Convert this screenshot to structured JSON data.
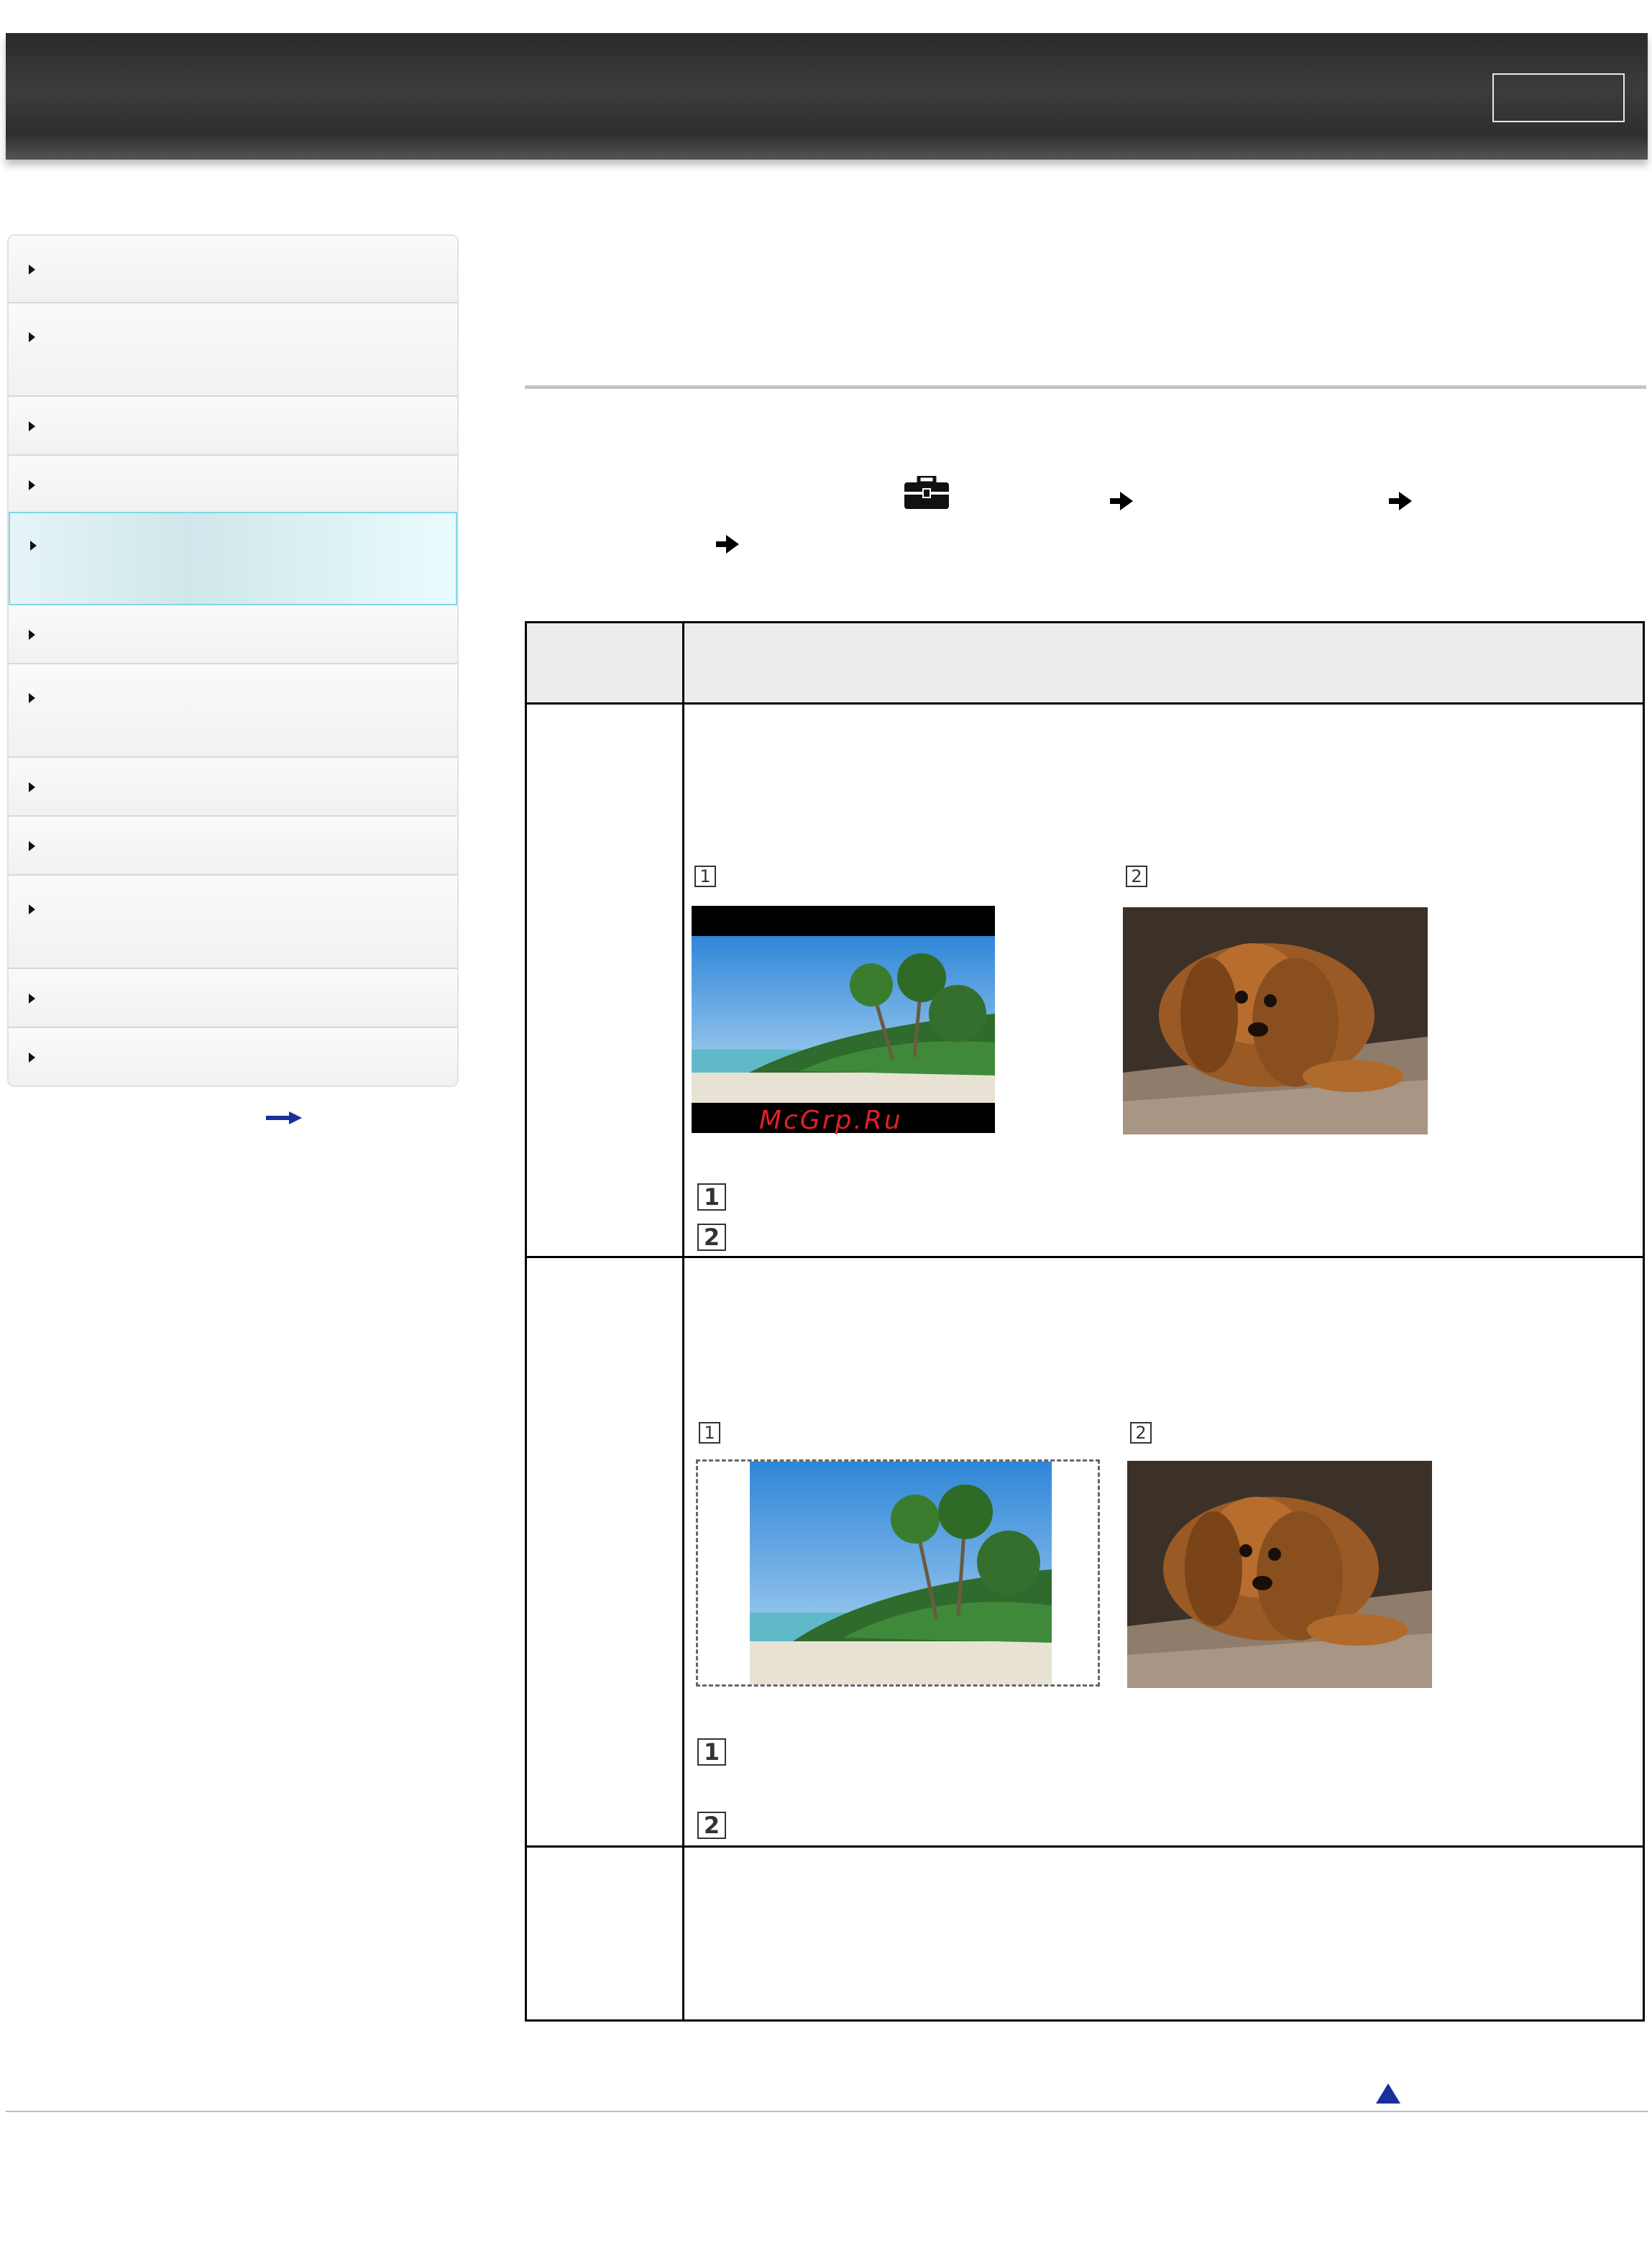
{
  "watermark": "McGrp.Ru",
  "sidebar": {
    "item_count": 12,
    "active_index": 4
  },
  "table": {
    "rows": [
      {
        "caption_markers": [
          "1",
          "2"
        ],
        "legend_markers": [
          "1",
          "2"
        ]
      },
      {
        "caption_markers": [
          "1",
          "2"
        ],
        "legend_markers": [
          "1",
          "2"
        ]
      },
      {
        "caption_markers": [],
        "legend_markers": []
      }
    ]
  },
  "icons": {
    "menu_icon": "toolbox-icon",
    "step_arrow": "arrow-right-icon",
    "back_to_top": "triangle-up-icon",
    "more_link": "long-arrow-right-icon"
  },
  "colors": {
    "header_dark": "#2e2e2e",
    "active_border": "#7fd8ea",
    "watermark_red": "#e0202a",
    "link_blue": "#1a2f9a"
  }
}
